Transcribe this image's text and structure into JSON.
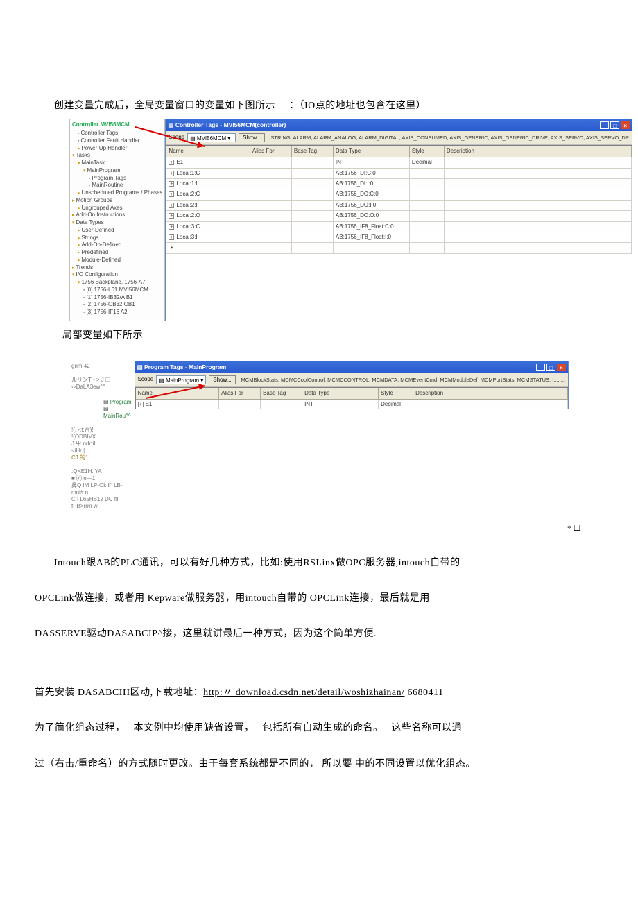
{
  "intro": {
    "p1_before": "创建变量完成后，全局变量窗口的变量如下图所示",
    "p1_after": "：（IO点的地址也包含在这里）"
  },
  "shot1": {
    "tree_title": "Controller MVI56MCM",
    "tree": [
      {
        "t": "Controller Tags",
        "d": 1,
        "c": "ico"
      },
      {
        "t": "Controller Fault Handler",
        "d": 1,
        "c": "ico"
      },
      {
        "t": "Power-Up Handler",
        "d": 1,
        "c": "folder"
      },
      {
        "t": "Tasks",
        "d": 0,
        "c": "folder-open"
      },
      {
        "t": "MainTask",
        "d": 1,
        "c": "folder-open"
      },
      {
        "t": "MainProgram",
        "d": 2,
        "c": "folder-open"
      },
      {
        "t": "Program Tags",
        "d": 3,
        "c": "ico"
      },
      {
        "t": "MainRoutine",
        "d": 3,
        "c": "ico"
      },
      {
        "t": "Unscheduled Programs / Phases",
        "d": 1,
        "c": "folder"
      },
      {
        "t": "Motion Groups",
        "d": 0,
        "c": "folder"
      },
      {
        "t": "Ungrouped Axes",
        "d": 1,
        "c": "folder"
      },
      {
        "t": "Add-On Instructions",
        "d": 0,
        "c": "folder"
      },
      {
        "t": "Data Types",
        "d": 0,
        "c": "folder-open"
      },
      {
        "t": "User-Defined",
        "d": 1,
        "c": "folder"
      },
      {
        "t": "Strings",
        "d": 1,
        "c": "folder"
      },
      {
        "t": "Add-On-Defined",
        "d": 1,
        "c": "folder"
      },
      {
        "t": "Predefined",
        "d": 1,
        "c": "folder"
      },
      {
        "t": "Module-Defined",
        "d": 1,
        "c": "folder"
      },
      {
        "t": "Trends",
        "d": 0,
        "c": "folder"
      },
      {
        "t": "I/O Configuration",
        "d": 0,
        "c": "folder-open"
      },
      {
        "t": "1756 Backplane, 1756-A7",
        "d": 1,
        "c": "folder-open"
      },
      {
        "t": "[0] 1756-L61 MVI56MCM",
        "d": 2,
        "c": "ico"
      },
      {
        "t": "[1] 1756-IB32/A B1",
        "d": 2,
        "c": "ico"
      },
      {
        "t": "[2] 1756-OB32 OB1",
        "d": 2,
        "c": "ico"
      },
      {
        "t": "[3] 1756-IF16 A2",
        "d": 2,
        "c": "ico"
      }
    ],
    "grid_title": "Controller Tags - MVI56MCM(controller)",
    "scope_label": "Scope",
    "scope_value": "MVI56MCM",
    "show_btn": "Show...",
    "filter": "STRING, ALARM, ALARM_ANALOG, ALARM_DIGITAL, AXIS_CONSUMED, AXIS_GENERIC, AXIS_GENERIC_DRIVE, AXIS_SERVO, AXIS_SERVO_DR",
    "columns": [
      "Name",
      "Alias For",
      "Base Tag",
      "Data Type",
      "Style",
      "Description"
    ],
    "rows": [
      {
        "name": "E1",
        "datatype": "INT",
        "style": "Decimal"
      },
      {
        "name": "Local:1:C",
        "datatype": "AB:1756_DI:C:0"
      },
      {
        "name": "Local:1:I",
        "datatype": "AB:1756_DI:I:0"
      },
      {
        "name": "Local:2:C",
        "datatype": "AB:1756_DO:C:0"
      },
      {
        "name": "Local:2:I",
        "datatype": "AB:1756_DO:I:0"
      },
      {
        "name": "Local:2:O",
        "datatype": "AB:1756_DO:O:0"
      },
      {
        "name": "Local:3:C",
        "datatype": "AB:1756_IF8_Float:C:0"
      },
      {
        "name": "Local:3:I",
        "datatype": "AB:1756_IF8_Float:I:0"
      }
    ]
  },
  "caption1": "局部变量如下所示",
  "shot2": {
    "tree_misc": [
      "gnm 42",
      "ルリンT - > J ❏ ∾DaLA3ew^^",
      "!(. -;t:否)!",
      "!(ODBIVX",
      "J 屮 nrIrtil",
      "<iHr |",
      "CJ 的1",
      ".QKE1H. YA",
      " ■ ⒭ n—1 ",
      "  鼻Q IM LP-Ok il\" LB-mnl# n",
      "  C I L65HB12 DU fll fPB>rrm w"
    ],
    "program_label": "Program",
    "mainroutine_label": "MainRou^^",
    "grid_title": "Program Tags - MainProgram",
    "scope_label": "Scope",
    "scope_value": "MainProgram",
    "show_btn": "Show...",
    "filter": "MCMBlockStats, MCMCCoolControl, MCMCCONTROL, MCMDATA, MCMEventCmd, MCMModuleDef, MCMPortStats, MCMSTATUS, I.........",
    "columns": [
      "Name",
      "Alias For",
      "Base Tag",
      "Data Type",
      "Style",
      "Description"
    ],
    "rows": [
      {
        "name": "E1",
        "datatype": "INT",
        "style": "Decimal"
      }
    ]
  },
  "asterisk": "*口",
  "body": {
    "p1": "Intouch跟AB的PLC通讯，可以有好几种方式，比如:使用RSLinx做OPC服务器,intouch自带的",
    "p2": "OPCLink做连接，或者用 Kepware做服务器，用intouch自带的 OPCLink连接，最后就是用",
    "p3": "DASSERVE驱动DASABCIP^接，这里就讲最后一种方式，因为这个简单方便.",
    "p4_before": "首先安装 DASABCIH区动,下载地址：",
    "p4_link": "http:〃 download.csdn.net/detail/woshizhainan/",
    "p4_after": "      6680411",
    "p5": "为了简化组态过程，   本文例中均使用缺省设置，    包括所有自动生成的命名。   这些名称可以通",
    "p6": "过（右击/重命名）的方式随时更改。由于每套系统都是不同的，       所以要  中的不同设置以优化组态。"
  }
}
